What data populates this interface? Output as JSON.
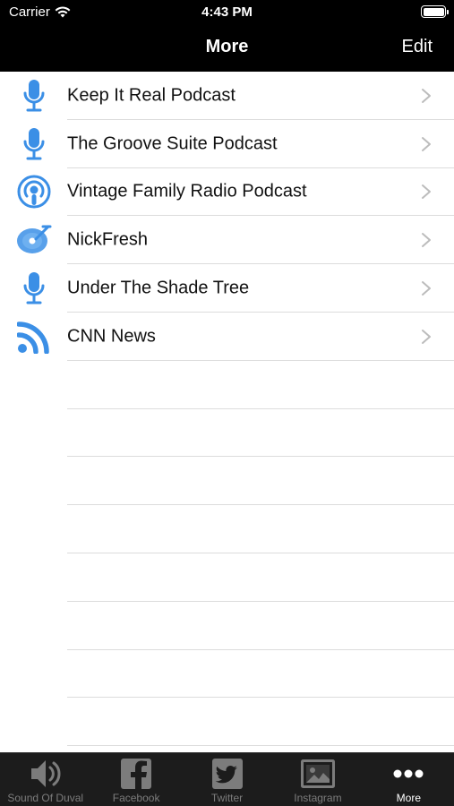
{
  "status_bar": {
    "carrier": "Carrier",
    "time": "4:43 PM"
  },
  "nav": {
    "title": "More",
    "edit_label": "Edit"
  },
  "colors": {
    "accent": "#3b8fe6",
    "nav_background": "#000000",
    "tab_background": "#1c1c1c",
    "tab_inactive": "#7c7c7c",
    "separator": "#dcdcdc"
  },
  "list": {
    "items": [
      {
        "label": "Keep It Real Podcast",
        "icon": "microphone-icon"
      },
      {
        "label": "The Groove Suite Podcast",
        "icon": "microphone-icon"
      },
      {
        "label": "Vintage Family Radio Podcast",
        "icon": "podcast-icon"
      },
      {
        "label": "NickFresh",
        "icon": "turntable-icon"
      },
      {
        "label": "Under The Shade Tree",
        "icon": "microphone-icon"
      },
      {
        "label": "CNN News",
        "icon": "rss-icon"
      }
    ]
  },
  "tabs": [
    {
      "label": "Sound Of Duval",
      "icon": "speaker-icon"
    },
    {
      "label": "Facebook",
      "icon": "facebook-icon"
    },
    {
      "label": "Twitter",
      "icon": "twitter-icon"
    },
    {
      "label": "Instagram",
      "icon": "image-icon"
    },
    {
      "label": "More",
      "icon": "more-icon",
      "selected": true
    }
  ]
}
